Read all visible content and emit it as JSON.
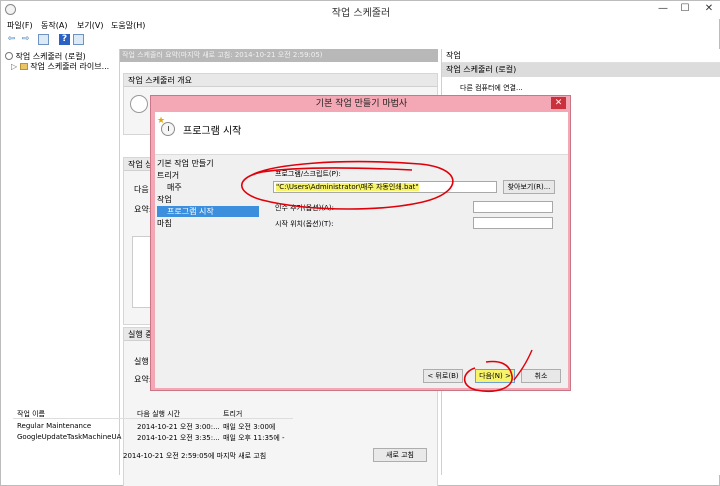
{
  "window": {
    "title": "작업 스케줄러",
    "minimize": "—",
    "maximize": "☐",
    "close": "✕"
  },
  "menu": [
    "파일(F)",
    "동작(A)",
    "보기(V)",
    "도움말(H)"
  ],
  "toolbar": {
    "back": "⇦",
    "forward": "⇨",
    "help": "?"
  },
  "tree": {
    "root": "작업 스케줄러 (로컬)",
    "child": "작업 스케줄러 라이브..."
  },
  "center": {
    "header": "작업 스케줄러 요약(마지막 새로 고침: 2014-10-21 오전 2:59:05)",
    "overview_title": "작업 스케줄러 개요",
    "status_title": "작업 상",
    "status_left1": "다음",
    "status_left2": "요약:",
    "active_title": "실행 중",
    "active_left1": "실행",
    "active_left2": "요약:",
    "table": {
      "headers": [
        "작업 이름",
        "다음 실행 시간",
        "트리거"
      ],
      "rows": [
        [
          "Regular Maintenance",
          "2014-10-21 오전 3:00:...",
          "매일 오전 3:00에"
        ],
        [
          "GoogleUpdateTaskMachineUA",
          "2014-10-21 오전 3:35:...",
          "매일 오후 11:35에 -"
        ]
      ]
    },
    "status_bar": "2014-10-21 오전 2:59:05에 마지막 새로 고침",
    "refresh_button": "새로 고침"
  },
  "right": {
    "header": "작업",
    "selected": "작업 스케줄러 (로컬)",
    "item": "다른 컴퓨터에 연결..."
  },
  "dialog": {
    "title": "기본 작업 만들기 마법사",
    "close": "✕",
    "page_title": "프로그램 시작",
    "steps": [
      "기본 작업 만들기",
      "트리거",
      "매주",
      "작업",
      "프로그램 시작",
      "마침"
    ],
    "program_label": "프로그램/스크립트(P):",
    "program_value": "\"C:\\Users\\Administrator\\매주 자동인쇄.bat\"",
    "browse_button": "찾아보기(R)...",
    "args_label": "인수 추가(옵션)(A):",
    "startin_label": "시작 위치(옵션)(T):",
    "back_button": "< 뒤로(B)",
    "next_button": "다음(N) >",
    "cancel_button": "취소"
  },
  "colors": {
    "dialog_bg": "#f4a8b5",
    "highlight": "#f7f36a",
    "annotation": "#e0000a",
    "selected_step": "#3b8fdc"
  }
}
